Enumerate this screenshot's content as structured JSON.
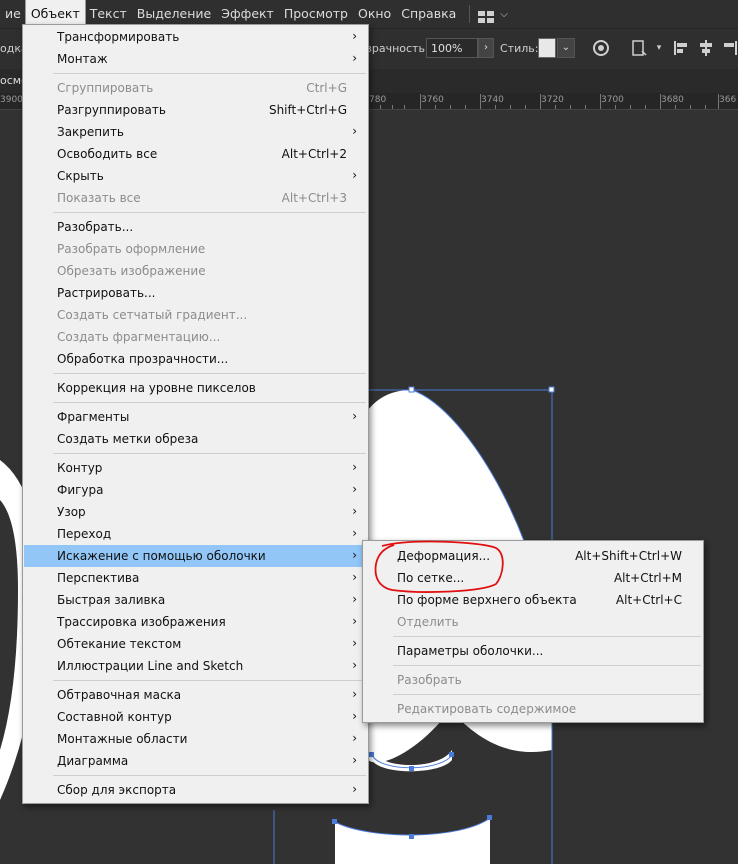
{
  "menubar": {
    "items": [
      {
        "label": "ие",
        "active": false
      },
      {
        "label": "Объект",
        "active": true
      },
      {
        "label": "Текст",
        "active": false
      },
      {
        "label": "Выделение",
        "active": false
      },
      {
        "label": "Эффект",
        "active": false
      },
      {
        "label": "Просмотр",
        "active": false
      },
      {
        "label": "Окно",
        "active": false
      },
      {
        "label": "Справка",
        "active": false
      }
    ],
    "workspace_icon": "layout-grid-icon"
  },
  "controlbar": {
    "left_partial": "одказ",
    "opacity_label": "зрачность:",
    "opacity_value": "100%",
    "style_label": "Стиль:"
  },
  "tab": {
    "partial_title": "осмо"
  },
  "ruler": {
    "labels": [
      "3900",
      "780",
      "3760",
      "3740",
      "3720",
      "3700",
      "3680",
      "366"
    ]
  },
  "main_menu": {
    "items": [
      {
        "label": "Трансформировать",
        "shortcut": "",
        "submenu": true,
        "disabled": false
      },
      {
        "label": "Монтаж",
        "shortcut": "",
        "submenu": true,
        "disabled": false
      },
      {
        "separator": true
      },
      {
        "label": "Сгруппировать",
        "shortcut": "Ctrl+G",
        "submenu": false,
        "disabled": true
      },
      {
        "label": "Разгруппировать",
        "shortcut": "Shift+Ctrl+G",
        "submenu": false,
        "disabled": false
      },
      {
        "label": "Закрепить",
        "shortcut": "",
        "submenu": true,
        "disabled": false
      },
      {
        "label": "Освободить все",
        "shortcut": "Alt+Ctrl+2",
        "submenu": false,
        "disabled": false
      },
      {
        "label": "Скрыть",
        "shortcut": "",
        "submenu": true,
        "disabled": false
      },
      {
        "label": "Показать все",
        "shortcut": "Alt+Ctrl+3",
        "submenu": false,
        "disabled": true
      },
      {
        "separator": true
      },
      {
        "label": "Разобрать...",
        "shortcut": "",
        "submenu": false,
        "disabled": false
      },
      {
        "label": "Разобрать оформление",
        "shortcut": "",
        "submenu": false,
        "disabled": true
      },
      {
        "label": "Обрезать изображение",
        "shortcut": "",
        "submenu": false,
        "disabled": true
      },
      {
        "label": "Растрировать...",
        "shortcut": "",
        "submenu": false,
        "disabled": false
      },
      {
        "label": "Создать сетчатый градиент...",
        "shortcut": "",
        "submenu": false,
        "disabled": true
      },
      {
        "label": "Создать фрагментацию...",
        "shortcut": "",
        "submenu": false,
        "disabled": true
      },
      {
        "label": "Обработка прозрачности...",
        "shortcut": "",
        "submenu": false,
        "disabled": false
      },
      {
        "separator": true
      },
      {
        "label": "Коррекция на уровне пикселов",
        "shortcut": "",
        "submenu": false,
        "disabled": false
      },
      {
        "separator": true
      },
      {
        "label": "Фрагменты",
        "shortcut": "",
        "submenu": true,
        "disabled": false
      },
      {
        "label": "Создать метки обреза",
        "shortcut": "",
        "submenu": false,
        "disabled": false
      },
      {
        "separator": true
      },
      {
        "label": "Контур",
        "shortcut": "",
        "submenu": true,
        "disabled": false
      },
      {
        "label": "Фигура",
        "shortcut": "",
        "submenu": true,
        "disabled": false
      },
      {
        "label": "Узор",
        "shortcut": "",
        "submenu": true,
        "disabled": false
      },
      {
        "label": "Переход",
        "shortcut": "",
        "submenu": true,
        "disabled": false
      },
      {
        "label": "Искажение с помощью оболочки",
        "shortcut": "",
        "submenu": true,
        "disabled": false,
        "highlight": true
      },
      {
        "label": "Перспектива",
        "shortcut": "",
        "submenu": true,
        "disabled": false
      },
      {
        "label": "Быстрая заливка",
        "shortcut": "",
        "submenu": true,
        "disabled": false
      },
      {
        "label": "Трассировка изображения",
        "shortcut": "",
        "submenu": true,
        "disabled": false
      },
      {
        "label": "Обтекание текстом",
        "shortcut": "",
        "submenu": true,
        "disabled": false
      },
      {
        "label": "Иллюстрации Line and Sketch",
        "shortcut": "",
        "submenu": true,
        "disabled": false
      },
      {
        "separator": true
      },
      {
        "label": "Обтравочная маска",
        "shortcut": "",
        "submenu": true,
        "disabled": false
      },
      {
        "label": "Составной контур",
        "shortcut": "",
        "submenu": true,
        "disabled": false
      },
      {
        "label": "Монтажные области",
        "shortcut": "",
        "submenu": true,
        "disabled": false
      },
      {
        "label": "Диаграмма",
        "shortcut": "",
        "submenu": true,
        "disabled": false
      },
      {
        "separator": true
      },
      {
        "label": "Сбор для экспорта",
        "shortcut": "",
        "submenu": true,
        "disabled": false
      }
    ]
  },
  "sub_menu": {
    "items": [
      {
        "label": "Деформация...",
        "shortcut": "Alt+Shift+Ctrl+W",
        "disabled": false
      },
      {
        "label": "По сетке...",
        "shortcut": "Alt+Ctrl+M",
        "disabled": false
      },
      {
        "label": "По форме верхнего объекта",
        "shortcut": "Alt+Ctrl+C",
        "disabled": false
      },
      {
        "label": "Отделить",
        "shortcut": "",
        "disabled": true
      },
      {
        "separator": true
      },
      {
        "label": "Параметры оболочки...",
        "shortcut": "",
        "disabled": false
      },
      {
        "separator": true
      },
      {
        "label": "Разобрать",
        "shortcut": "",
        "disabled": true
      },
      {
        "separator": true
      },
      {
        "label": "Редактировать содержимое",
        "shortcut": "",
        "disabled": true
      }
    ]
  },
  "colors": {
    "menu_bg": "#f0f0f0",
    "highlight": "#91c6f6",
    "disabled_text": "#8c8c8c",
    "canvas_bg": "#323232",
    "selection_blue": "#4a7bd8",
    "annotation_red": "#e01010"
  }
}
